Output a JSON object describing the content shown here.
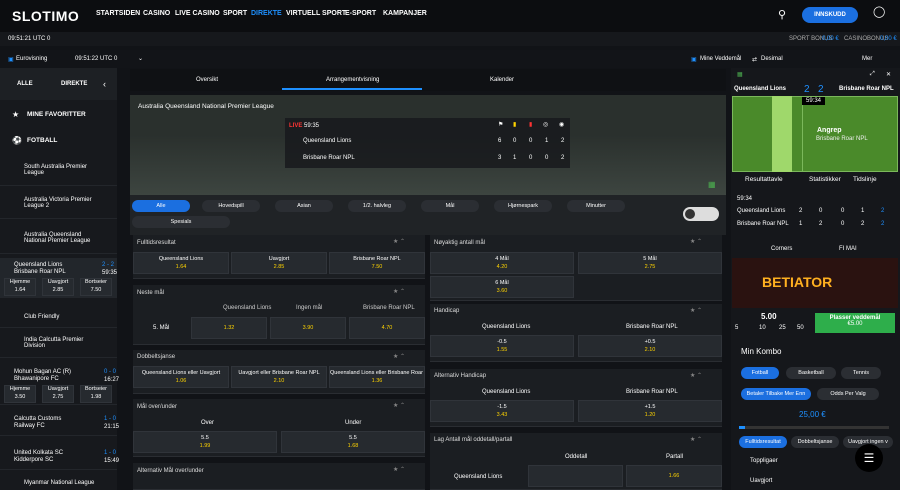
{
  "logo": "SLOTIMO",
  "nav": [
    "STARTSIDEN",
    "CASINO",
    "LIVE CASINO",
    "SPORT",
    "DIREKTE",
    "VIRTUELL SPORT",
    "E-SPORT",
    "KAMPANJER"
  ],
  "login": "INNSKUDD",
  "bar2": {
    "time": "09:51:21 UTC 0",
    "sport_bonus": "SPORT BONUS",
    "sport_bonus_val": "0,00 €",
    "casino_bonus": "CASINOBONUS",
    "casino_bonus_val": "0,00 €"
  },
  "bar3": {
    "left": "Eurovisning",
    "time2": "09:51:22 UTC 0",
    "mine": "Mine Veddemål",
    "desimal": "Desimal",
    "mer": "Mer"
  },
  "sidebar": {
    "tabs": [
      "ALLE",
      "DIREKTE"
    ],
    "favorites": "MINE FAVORITTER",
    "football": "FOTBALL",
    "leagues": [
      "South Australia Premier League",
      "Australia Victoria Premier League 2",
      "Australia Queensland National Premier League"
    ],
    "match": {
      "t1": "Queensland Lions",
      "t2": "Brisbane Roar NPL",
      "score": "2 - 2",
      "time": "59:35",
      "h": "Hjemme",
      "u": "Uavgjort",
      "b": "Bortseier",
      "hv": "1.64",
      "uv": "2.85",
      "bv": "7.50"
    },
    "others": [
      "Club Friendly",
      "India Calcutta Premier Division"
    ],
    "match2": {
      "t1": "Mohun Bagan AC (R)",
      "t2": "Bhawanipore FC",
      "score": "0 - 0",
      "time": "16:27",
      "hv": "3.50",
      "uv": "2.75",
      "bv": "1.98"
    },
    "match3": {
      "t1": "Calcutta Customs",
      "t2": "Railway FC",
      "score": "1 - 0",
      "time": "21:15"
    },
    "match4": {
      "t1": "United Kolkata SC",
      "t2": "Kidderpore SC",
      "score": "1 - 0",
      "time": "15:49"
    },
    "last": "Myanmar National League"
  },
  "tabs": [
    "Oversikt",
    "Arrangementvisning",
    "Kalender"
  ],
  "event": {
    "league": "Australia Queensland National Premier League",
    "live": "LIVE",
    "time": "59:35",
    "t1": "Queensland Lions",
    "t2": "Brisbane Roar NPL",
    "s1": [
      "6",
      "0",
      "0",
      "1",
      "2"
    ],
    "s2": [
      "3",
      "1",
      "0",
      "0",
      "2"
    ]
  },
  "filters": [
    "Alle",
    "Hovedspill",
    "Asian",
    "1/2. halvleg",
    "Mål",
    "Hjørnespark",
    "Minutter",
    "Spesials"
  ],
  "markets": {
    "ft": {
      "title": "Fulltidsresultat",
      "a": "Queensland Lions",
      "av": "1.64",
      "b": "Uavgjort",
      "bv": "2.85",
      "c": "Brisbane Roar NPL",
      "cv": "7.50"
    },
    "next": {
      "title": "Neste mål",
      "label": "5. Mål",
      "a": "Queensland Lions",
      "av": "1.32",
      "b": "Ingen mål",
      "bv": "3.90",
      "c": "Brisbane Roar NPL",
      "cv": "4.70"
    },
    "dc": {
      "title": "Dobbeltsjanse",
      "a": "Queensland Lions eller Uavgjort",
      "av": "1.06",
      "b": "Uavgjort eller Brisbane Roar NPL",
      "bv": "2.10",
      "c": "Queensland Lions eller Brisbane Roar N",
      "cv": "1.36"
    },
    "ou": {
      "title": "Mål over/under",
      "a": "Over",
      "b": "Under",
      "line": "5.5",
      "av": "1.99",
      "bv": "1.68"
    },
    "altou": {
      "title": "Alternativ Mål over/under"
    },
    "exact": {
      "title": "Nøyaktig antall mål",
      "a": "4 Mål",
      "av": "4.20",
      "b": "5 Mål",
      "bv": "2.75",
      "c": "6 Mål",
      "cv": "3.60"
    },
    "hc": {
      "title": "Handicap",
      "a": "Queensland Lions",
      "b": "Brisbane Roar NPL",
      "al": "-0.5",
      "av": "1.55",
      "bl": "+0.5",
      "bv": "2.10"
    },
    "ahc": {
      "title": "Alternativ Handicap",
      "a": "Queensland Lions",
      "b": "Brisbane Roar NPL",
      "al": "-1.5",
      "av": "3.43",
      "bl": "+1.5",
      "bv": "1.20"
    },
    "team": {
      "title": "Lag Antall mål oddetall/partall",
      "a": "Oddetall",
      "b": "Partall",
      "row": "Queensland Lions",
      "bv": "1.66"
    }
  },
  "right": {
    "t1": "Queensland Lions",
    "t2": "Brisbane Roar NPL",
    "s": "2",
    "s2": "2",
    "time": "59:34",
    "attack": "Angrep",
    "attack_team": "Brisbane Roar NPL",
    "tabs": [
      "Resultattavle",
      "Statistikker",
      "Tidslinje"
    ],
    "time2": "59:34",
    "r1": [
      "Queensland Lions",
      "2",
      "0",
      "0",
      "1",
      "2"
    ],
    "r2": [
      "Brisbane Roar NPL",
      "1",
      "2",
      "0",
      "2",
      "2"
    ],
    "corner": "Corners",
    "fi": "FI MAI",
    "banner": "BETIATOR",
    "amounts": [
      "5.00",
      "5",
      "10",
      "25",
      "50"
    ],
    "place": "Plasser veddemål",
    "place_amt": "€5.00",
    "kombo": "Min Kombo",
    "sports": [
      "Fotball",
      "Basketball",
      "Tennis"
    ],
    "bt1": "Betaler Tilbake Mer Enn",
    "bt2": "Odds Per Valg",
    "amount": "25,00 €",
    "chips": [
      "Fulltidsresultat",
      "Dobbeltsjanse",
      "Uavgjort ingen v"
    ],
    "top": "Toppligaer",
    "uav": "Uavgjort"
  }
}
